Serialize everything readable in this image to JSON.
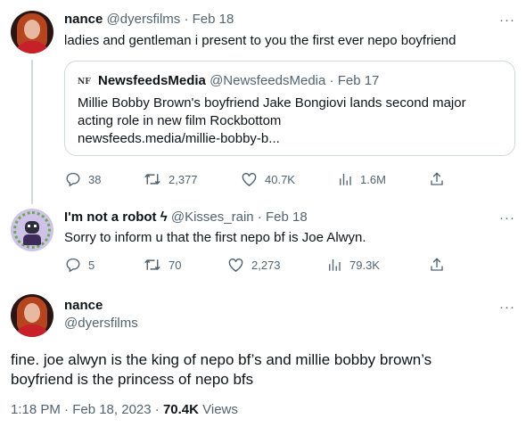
{
  "tweet1": {
    "name": "nance",
    "handle": "@dyersfilms",
    "sep": "·",
    "date": "Feb 18",
    "text": "ladies and gentleman i present to you the first ever nepo boyfriend",
    "quote": {
      "logo": "NF",
      "name": "NewsfeedsMedia",
      "handle": "@NewsfeedsMedia",
      "sep": "·",
      "date": "Feb 17",
      "lines": [
        "Millie Bobby Brown's boyfriend Jake Bongiovi lands second major",
        "acting role in new film Rockbottom",
        "newsfeeds.media/millie-bobby-b..."
      ]
    },
    "actions": {
      "replies": "38",
      "retweets": "2,377",
      "likes": "40.7K",
      "views": "1.6M"
    }
  },
  "tweet2": {
    "name": "I'm not a robot",
    "badge": "ϟ",
    "handle": "@Kisses_rain",
    "sep": "·",
    "date": "Feb 18",
    "text": "Sorry to inform u that the first nepo bf is Joe Alwyn.",
    "actions": {
      "replies": "5",
      "retweets": "70",
      "likes": "2,273",
      "views": "79.3K"
    }
  },
  "tweet3": {
    "name": "nance",
    "handle": "@dyersfilms",
    "lines": [
      "fine. joe alwyn is the king of nepo bf’s and millie bobby brown’s",
      "boyfriend is the princess of nepo bfs"
    ],
    "timestamp": "1:18 PM · Feb 18, 2023 · ",
    "views_count": "70.4K",
    "views_label": " Views"
  },
  "more_label": "···",
  "icons": [
    "reply-icon",
    "retweet-icon",
    "like-icon",
    "views-icon",
    "share-icon",
    "more-icon"
  ],
  "colors": {
    "text": "#0f1419",
    "muted": "#536471",
    "border": "#cfd9de"
  }
}
